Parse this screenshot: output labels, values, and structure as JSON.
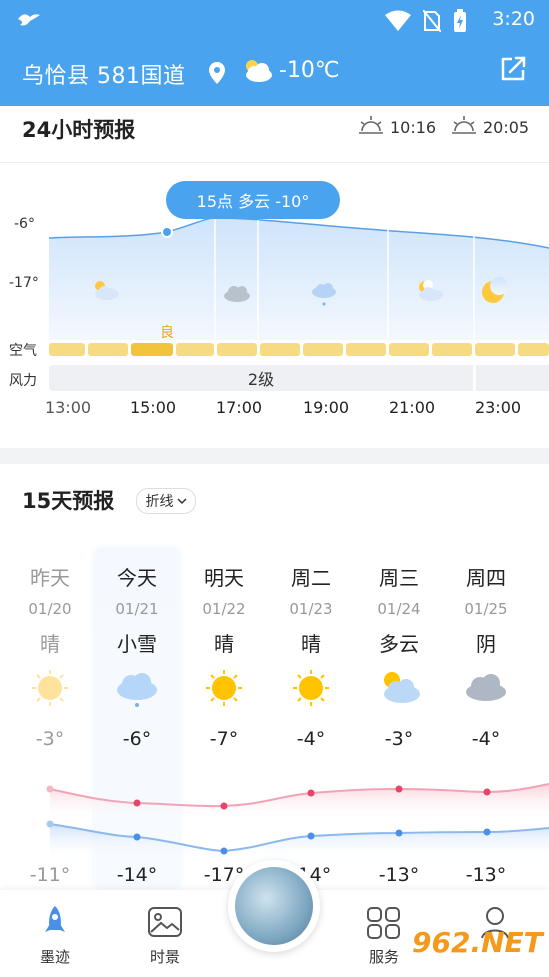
{
  "status_bar": {
    "time": "3:20"
  },
  "header": {
    "location": "乌恰县 581国道",
    "temperature": "-10℃"
  },
  "hourly": {
    "title": "24小时预报",
    "sunrise": "10:16",
    "sunset": "20:05",
    "y_labels": [
      "-6°",
      "-17°"
    ],
    "tooltip": "15点 多云 -10°",
    "air_label": "空气",
    "wind_label": "风力",
    "air_quality_mark": "良",
    "wind_level": "2级",
    "hours": [
      "13:00",
      "15:00",
      "17:00",
      "19:00",
      "21:00",
      "23:00"
    ],
    "icons": [
      "partly-cloudy-day-icon",
      "cloudy-icon",
      "snow-icon",
      "partly-cloudy-night-icon",
      "moon-icon"
    ]
  },
  "daily": {
    "title": "15天预报",
    "toggle_label": "折线",
    "days": [
      {
        "name": "昨天",
        "date": "01/20",
        "condition": "晴",
        "icon": "sun-icon",
        "high": "-3°",
        "low": "-11°"
      },
      {
        "name": "今天",
        "date": "01/21",
        "condition": "小雪",
        "icon": "snow-cloud-icon",
        "high": "-6°",
        "low": "-14°"
      },
      {
        "name": "明天",
        "date": "01/22",
        "condition": "晴",
        "icon": "sun-icon",
        "high": "-7°",
        "low": "-17°"
      },
      {
        "name": "周二",
        "date": "01/23",
        "condition": "晴",
        "icon": "sun-icon",
        "high": "-4°",
        "low": "-14°"
      },
      {
        "name": "周三",
        "date": "01/24",
        "condition": "多云",
        "icon": "partly-cloudy-icon",
        "high": "-3°",
        "low": "-13°"
      },
      {
        "name": "周四",
        "date": "01/25",
        "condition": "阴",
        "icon": "overcast-icon",
        "high": "-4°",
        "low": "-13°"
      }
    ]
  },
  "nav": {
    "items": [
      {
        "label": "墨迹"
      },
      {
        "label": "时景"
      },
      {
        "label": "服务"
      }
    ]
  },
  "watermark": "962.NET",
  "colors": {
    "accent": "#4aa3ef",
    "high_line": "#e6456a",
    "low_line": "#4a8fe8",
    "air_bar": "#f5d778"
  }
}
